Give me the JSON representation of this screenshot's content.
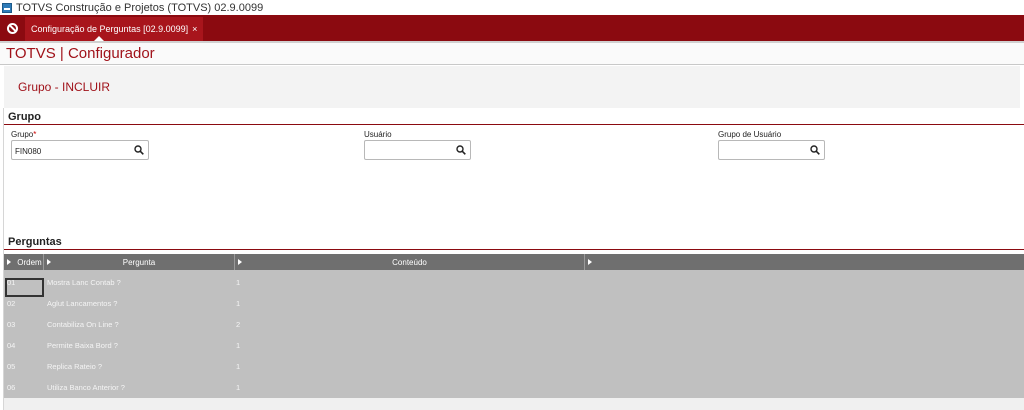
{
  "window": {
    "title": "TOTVS Construção e Projetos (TOTVS) 02.9.0099"
  },
  "tabbar": {
    "tab_label": "Configuração de Perguntas [02.9.0099]",
    "close_glyph": "×"
  },
  "app": {
    "title": "TOTVS | Configurador"
  },
  "page": {
    "title": "Grupo - INCLUIR"
  },
  "grupo_section": {
    "title": "Grupo",
    "grupo": {
      "label": "Grupo",
      "required_mark": "*",
      "value": "FIN080"
    },
    "usuario": {
      "label": "Usuário",
      "value": ""
    },
    "grupo_usuario": {
      "label": "Grupo de Usuário",
      "value": ""
    }
  },
  "perguntas_section": {
    "title": "Perguntas",
    "columns": [
      "Ordem",
      "Pergunta",
      "Conteúdo"
    ],
    "rows": [
      {
        "ordem": "01",
        "pergunta": "Mostra Lanc Contab ?",
        "conteudo": "1"
      },
      {
        "ordem": "02",
        "pergunta": "Aglut Lancamentos ?",
        "conteudo": "1"
      },
      {
        "ordem": "03",
        "pergunta": "Contabiliza On Line ?",
        "conteudo": "2"
      },
      {
        "ordem": "04",
        "pergunta": "Permite Baixa Bord ?",
        "conteudo": "1"
      },
      {
        "ordem": "05",
        "pergunta": "Replica Rateio ?",
        "conteudo": "1"
      },
      {
        "ordem": "06",
        "pergunta": "Utiliza Banco Anterior ?",
        "conteudo": "1"
      }
    ]
  },
  "colors": {
    "brand": "#8b0a10",
    "accent_text": "#a0121a",
    "grid_header": "#6f6f6f",
    "grid_body": "#c0c0c0"
  },
  "icons": [
    "app-icon",
    "home-icon",
    "close-icon",
    "search-icon",
    "sort-arrow-icon"
  ]
}
